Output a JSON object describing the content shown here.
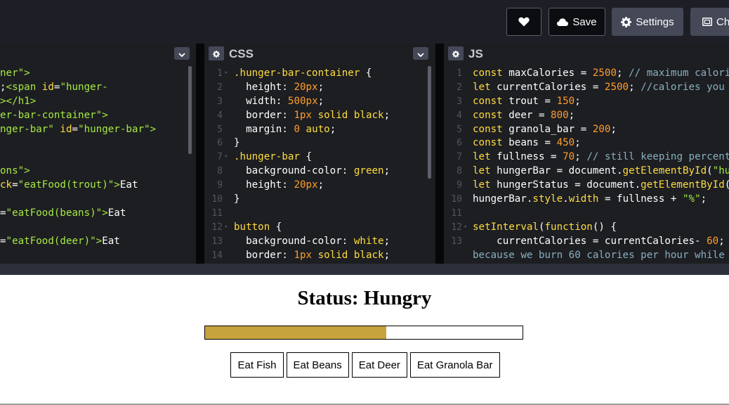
{
  "toolbar": {
    "heart_icon": "heart-icon",
    "save_label": "Save",
    "settings_label": "Settings",
    "change_label": "Cha"
  },
  "editors": {
    "html": {
      "lines": [
        [
          [
            "c-tag",
            "ner\">"
          ]
        ],
        [
          [
            "c-plain",
            ";"
          ],
          [
            "c-tag",
            "<span "
          ],
          [
            "c-attr",
            "id"
          ],
          [
            "c-plain",
            "="
          ],
          [
            "c-tag",
            "\"hunger-"
          ]
        ],
        [
          [
            "c-tag",
            "></h1>"
          ]
        ],
        [
          [
            "c-tag",
            "er-bar-container\">"
          ]
        ],
        [
          [
            "c-tag",
            "nger-bar\" "
          ],
          [
            "c-attr",
            "id"
          ],
          [
            "c-plain",
            "="
          ],
          [
            "c-tag",
            "\"hunger-bar\">"
          ]
        ],
        [],
        [],
        [
          [
            "c-tag",
            "ons\">"
          ]
        ],
        [
          [
            "c-attr",
            "ck"
          ],
          [
            "c-plain",
            "="
          ],
          [
            "c-tag",
            "\"eatFood(trout)\">"
          ],
          [
            "c-plain",
            "Eat"
          ]
        ],
        [],
        [
          [
            "c-plain",
            "="
          ],
          [
            "c-tag",
            "\"eatFood(beans)\">"
          ],
          [
            "c-plain",
            "Eat"
          ]
        ],
        [],
        [
          [
            "c-plain",
            "="
          ],
          [
            "c-tag",
            "\"eatFood(deer)\">"
          ],
          [
            "c-plain",
            "Eat"
          ]
        ],
        []
      ]
    },
    "css": {
      "title": "CSS",
      "lines": [
        {
          "n": "1",
          "fold": true,
          "t": [
            [
              "c-sel",
              ".hunger-bar-container"
            ],
            [
              "c-plain",
              " {"
            ]
          ]
        },
        {
          "n": "2",
          "t": [
            [
              "c-plain",
              "  "
            ],
            [
              "c-val",
              "height"
            ],
            [
              "c-plain",
              ": "
            ],
            [
              "c-num",
              "20px"
            ],
            [
              "c-plain",
              ";"
            ]
          ]
        },
        {
          "n": "3",
          "t": [
            [
              "c-plain",
              "  "
            ],
            [
              "c-val",
              "width"
            ],
            [
              "c-plain",
              ": "
            ],
            [
              "c-num",
              "500px"
            ],
            [
              "c-plain",
              ";"
            ]
          ]
        },
        {
          "n": "4",
          "t": [
            [
              "c-plain",
              "  "
            ],
            [
              "c-val",
              "border"
            ],
            [
              "c-plain",
              ": "
            ],
            [
              "c-num",
              "1px"
            ],
            [
              "c-plain",
              " "
            ],
            [
              "c-sel",
              "solid black"
            ],
            [
              "c-plain",
              ";"
            ]
          ]
        },
        {
          "n": "5",
          "t": [
            [
              "c-plain",
              "  "
            ],
            [
              "c-val",
              "margin"
            ],
            [
              "c-plain",
              ": "
            ],
            [
              "c-num",
              "0"
            ],
            [
              "c-plain",
              " "
            ],
            [
              "c-sel",
              "auto"
            ],
            [
              "c-plain",
              ";"
            ]
          ]
        },
        {
          "n": "6",
          "t": [
            [
              "c-plain",
              "}"
            ]
          ]
        },
        {
          "n": "7",
          "fold": true,
          "t": [
            [
              "c-sel",
              ".hunger-bar"
            ],
            [
              "c-plain",
              " {"
            ]
          ]
        },
        {
          "n": "8",
          "t": [
            [
              "c-plain",
              "  "
            ],
            [
              "c-val",
              "background-color"
            ],
            [
              "c-plain",
              ": "
            ],
            [
              "c-sel",
              "green"
            ],
            [
              "c-plain",
              ";"
            ]
          ]
        },
        {
          "n": "9",
          "t": [
            [
              "c-plain",
              "  "
            ],
            [
              "c-val",
              "height"
            ],
            [
              "c-plain",
              ": "
            ],
            [
              "c-num",
              "20px"
            ],
            [
              "c-plain",
              ";"
            ]
          ]
        },
        {
          "n": "10",
          "t": [
            [
              "c-plain",
              "}"
            ]
          ]
        },
        {
          "n": "11",
          "t": []
        },
        {
          "n": "12",
          "fold": true,
          "t": [
            [
              "c-sel",
              "button"
            ],
            [
              "c-plain",
              " {"
            ]
          ]
        },
        {
          "n": "13",
          "t": [
            [
              "c-plain",
              "  "
            ],
            [
              "c-val",
              "background-color"
            ],
            [
              "c-plain",
              ": "
            ],
            [
              "c-sel",
              "white"
            ],
            [
              "c-plain",
              ";"
            ]
          ]
        },
        {
          "n": "14",
          "t": [
            [
              "c-plain",
              "  "
            ],
            [
              "c-val",
              "border"
            ],
            [
              "c-plain",
              ": "
            ],
            [
              "c-num",
              "1px"
            ],
            [
              "c-plain",
              " "
            ],
            [
              "c-sel",
              "solid black"
            ],
            [
              "c-plain",
              ";"
            ]
          ]
        }
      ]
    },
    "js": {
      "title": "JS",
      "lines": [
        {
          "n": "1",
          "t": [
            [
              "c-kw",
              "const "
            ],
            [
              "c-plain",
              "maxCalories = "
            ],
            [
              "c-num",
              "2500"
            ],
            [
              "c-plain",
              "; "
            ],
            [
              "c-com",
              "// maximum calories"
            ]
          ]
        },
        {
          "n": "2",
          "t": [
            [
              "c-kw",
              "let "
            ],
            [
              "c-plain",
              "currentCalories = "
            ],
            [
              "c-num",
              "2500"
            ],
            [
              "c-plain",
              "; "
            ],
            [
              "c-com",
              "//calories you ne"
            ]
          ]
        },
        {
          "n": "3",
          "t": [
            [
              "c-kw",
              "const "
            ],
            [
              "c-plain",
              "trout = "
            ],
            [
              "c-num",
              "150"
            ],
            [
              "c-plain",
              ";"
            ]
          ]
        },
        {
          "n": "4",
          "t": [
            [
              "c-kw",
              "const "
            ],
            [
              "c-plain",
              "deer = "
            ],
            [
              "c-num",
              "800"
            ],
            [
              "c-plain",
              ";"
            ]
          ]
        },
        {
          "n": "5",
          "t": [
            [
              "c-kw",
              "const "
            ],
            [
              "c-plain",
              "granola_bar = "
            ],
            [
              "c-num",
              "200"
            ],
            [
              "c-plain",
              ";"
            ]
          ]
        },
        {
          "n": "6",
          "t": [
            [
              "c-kw",
              "const "
            ],
            [
              "c-plain",
              "beans = "
            ],
            [
              "c-num",
              "450"
            ],
            [
              "c-plain",
              ";"
            ]
          ]
        },
        {
          "n": "7",
          "t": [
            [
              "c-kw",
              "let "
            ],
            [
              "c-plain",
              "fullness = "
            ],
            [
              "c-num",
              "70"
            ],
            [
              "c-plain",
              "; "
            ],
            [
              "c-com",
              "// still keeping percentag"
            ]
          ]
        },
        {
          "n": "8",
          "t": [
            [
              "c-kw",
              "let "
            ],
            [
              "c-plain",
              "hungerBar = document."
            ],
            [
              "c-func",
              "getElementById"
            ],
            [
              "c-plain",
              "("
            ],
            [
              "c-str",
              "\"hung"
            ]
          ]
        },
        {
          "n": "9",
          "t": [
            [
              "c-kw",
              "let "
            ],
            [
              "c-plain",
              "hungerStatus = document."
            ],
            [
              "c-func",
              "getElementById"
            ],
            [
              "c-plain",
              "("
            ],
            [
              "c-str",
              "\"h"
            ]
          ]
        },
        {
          "n": "10",
          "t": [
            [
              "c-plain",
              "hungerBar."
            ],
            [
              "c-func",
              "style"
            ],
            [
              "c-plain",
              "."
            ],
            [
              "c-func",
              "width"
            ],
            [
              "c-plain",
              " = fullness + "
            ],
            [
              "c-str",
              "\"%\""
            ],
            [
              "c-plain",
              ";"
            ]
          ]
        },
        {
          "n": "11",
          "t": []
        },
        {
          "n": "12",
          "fold": true,
          "t": [
            [
              "c-func",
              "setInterval"
            ],
            [
              "c-plain",
              "("
            ],
            [
              "c-kw",
              "function"
            ],
            [
              "c-plain",
              "() {"
            ]
          ]
        },
        {
          "n": "13",
          "t": [
            [
              "c-plain",
              "    currentCalories = currentCalories- "
            ],
            [
              "c-num",
              "60"
            ],
            [
              "c-plain",
              "; "
            ],
            [
              "c-com",
              "//"
            ]
          ]
        },
        {
          "n": "",
          "t": [
            [
              "c-com",
              "because we burn 60 calories per hour while si"
            ]
          ]
        }
      ]
    }
  },
  "result": {
    "status_text": "Status: Hungry",
    "hunger_fill_fraction": 0.57,
    "hunger_fill_color": "#c7a33c",
    "buttons": [
      "Eat Fish",
      "Eat Beans",
      "Eat Deer",
      "Eat Granola Bar"
    ]
  }
}
